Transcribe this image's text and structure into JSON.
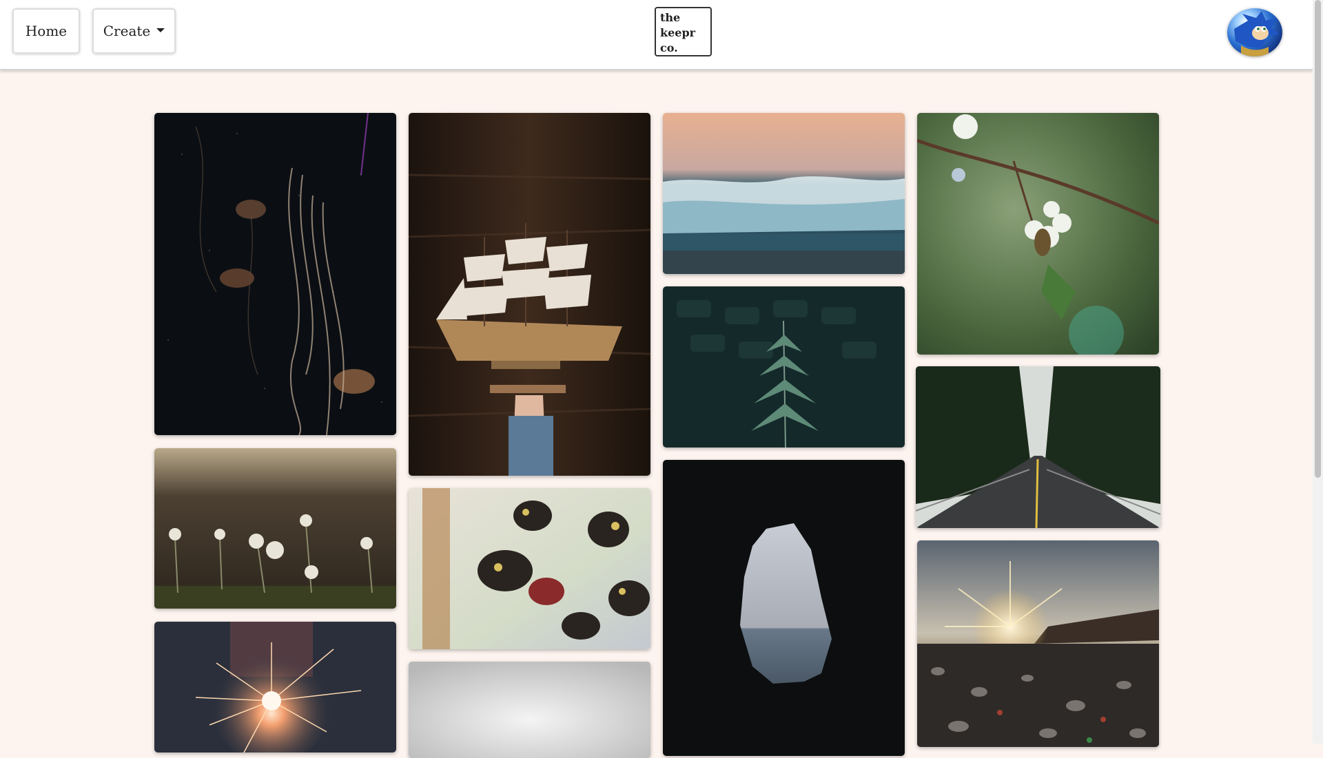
{
  "nav": {
    "home_label": "Home",
    "create_label": "Create",
    "logo_lines": [
      "the",
      "keepr",
      "co."
    ]
  },
  "colors": {
    "page_background": "#fdf4ef",
    "navbar_background": "#ffffff"
  },
  "gallery": {
    "images": [
      {
        "subject": "jellyfish"
      },
      {
        "subject": "model-sailing-ship"
      },
      {
        "subject": "ocean-waves"
      },
      {
        "subject": "blackberry-blossom-bee"
      },
      {
        "subject": "dandelions"
      },
      {
        "subject": "butterfly-display"
      },
      {
        "subject": "fern"
      },
      {
        "subject": "forest-road"
      },
      {
        "subject": "sparkler"
      },
      {
        "subject": "grey-gradient"
      },
      {
        "subject": "cave-opening-sea"
      },
      {
        "subject": "sunset-pebble-beach"
      }
    ]
  }
}
